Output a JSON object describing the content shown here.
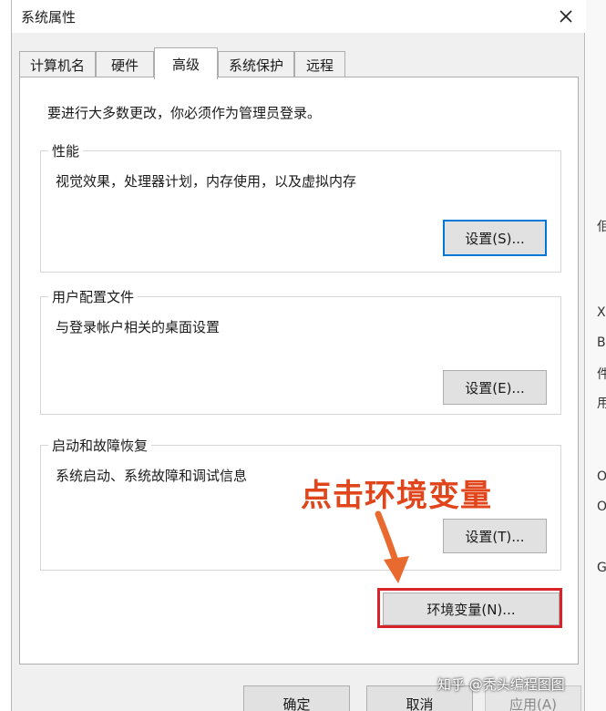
{
  "window": {
    "title": "系统属性",
    "close_icon": "close-icon"
  },
  "tabs": [
    {
      "label": "计算机名",
      "active": false
    },
    {
      "label": "硬件",
      "active": false
    },
    {
      "label": "高级",
      "active": true
    },
    {
      "label": "系统保护",
      "active": false
    },
    {
      "label": "远程",
      "active": false
    }
  ],
  "panel": {
    "intro": "要进行大多数更改，你必须作为管理员登录。",
    "performance": {
      "title": "性能",
      "desc": "视觉效果，处理器计划，内存使用，以及虚拟内存",
      "button": "设置(S)..."
    },
    "profiles": {
      "title": "用户配置文件",
      "desc": "与登录帐户相关的桌面设置",
      "button": "设置(E)..."
    },
    "startup": {
      "title": "启动和故障恢复",
      "desc": "系统启动、系统故障和调试信息",
      "button": "设置(T)..."
    },
    "env_button": "环境变量(N)..."
  },
  "footer": {
    "ok": "确定",
    "cancel": "取消",
    "apply": "应用(A)"
  },
  "annotation": {
    "text": "点击环境变量",
    "color": "#e0451b",
    "highlight_color": "#d8232a"
  },
  "watermark": "知乎 @秃头编程图图",
  "right_strip_chars": [
    "佀",
    "X",
    "B",
    "件",
    "用",
    "O",
    "O",
    "G"
  ]
}
